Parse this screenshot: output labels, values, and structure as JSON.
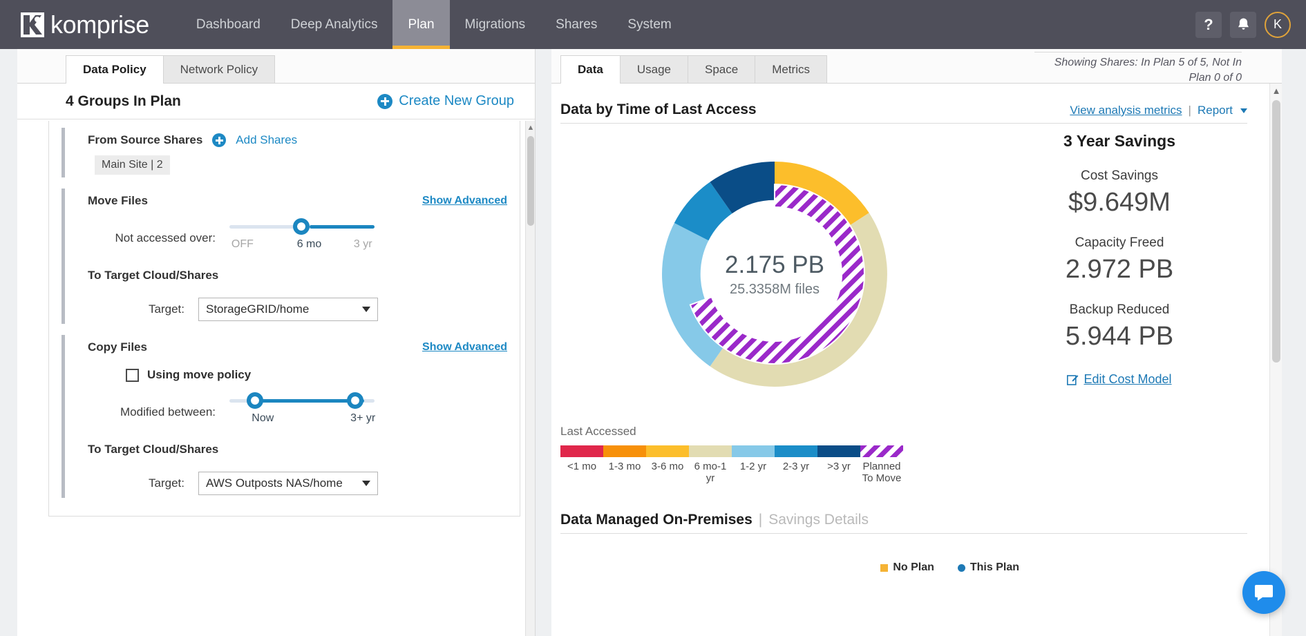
{
  "nav": {
    "brand": "komprise",
    "items": [
      {
        "label": "Dashboard",
        "active": false
      },
      {
        "label": "Deep Analytics",
        "active": false
      },
      {
        "label": "Plan",
        "active": true
      },
      {
        "label": "Migrations",
        "active": false
      },
      {
        "label": "Shares",
        "active": false
      },
      {
        "label": "System",
        "active": false
      }
    ],
    "help_icon": "?",
    "bell_icon": "bell-icon",
    "avatar_initial": "K"
  },
  "left": {
    "tabs": [
      {
        "label": "Data Policy",
        "active": true
      },
      {
        "label": "Network Policy",
        "active": false
      }
    ],
    "groups_title": "4 Groups In Plan",
    "create_group": "Create New Group",
    "source": {
      "title": "From Source Shares",
      "add_link": "Add Shares",
      "chip": "Main Site | 2"
    },
    "move": {
      "title": "Move Files",
      "advanced": "Show Advanced",
      "slider_label": "Not accessed over:",
      "ticks": [
        "OFF",
        "6 mo",
        "3 yr"
      ],
      "selected_tick": "6 mo",
      "target_head": "To Target Cloud/Shares",
      "target_label": "Target:",
      "target_value": "StorageGRID/home"
    },
    "copy": {
      "title": "Copy Files",
      "advanced": "Show Advanced",
      "checkbox_label": "Using move policy",
      "checkbox_checked": false,
      "slider_label": "Modified between:",
      "ticks": [
        "Now",
        "3+ yr"
      ],
      "target_head": "To Target Cloud/Shares",
      "target_label": "Target:",
      "target_value": "AWS Outposts NAS/home"
    }
  },
  "right": {
    "tabs": [
      {
        "label": "Data",
        "active": true
      },
      {
        "label": "Usage",
        "active": false
      },
      {
        "label": "Space",
        "active": false
      },
      {
        "label": "Metrics",
        "active": false
      }
    ],
    "showing_shares": "Showing Shares: In Plan 5 of 5, Not In Plan 0 of 0",
    "section_title": "Data by Time of Last Access",
    "view_metrics_link": "View analysis metrics",
    "report_link": "Report",
    "savings": {
      "heading": "3 Year Savings",
      "items": [
        {
          "label": "Cost Savings",
          "value": "$9.649M"
        },
        {
          "label": "Capacity Freed",
          "value": "2.972 PB"
        },
        {
          "label": "Backup Reduced",
          "value": "5.944 PB"
        }
      ],
      "edit_link": "Edit Cost Model"
    },
    "legend_title": "Last Accessed",
    "bottom": {
      "title": "Data Managed On-Premises",
      "separator": "|",
      "subtitle": "Savings Details",
      "mini_legend": [
        {
          "label": "No Plan",
          "color": "#f5b335",
          "shape": "square"
        },
        {
          "label": "This Plan",
          "color": "#1d79b5",
          "shape": "dot"
        }
      ]
    }
  },
  "chart_data": {
    "type": "pie",
    "title": "Data by Time of Last Access",
    "center_value": "2.175 PB",
    "center_subtitle": "25.3358M files",
    "legend_title": "Last Accessed",
    "legend_position": "bottom",
    "categories": [
      "<1 mo",
      "1-3 mo",
      "3-6 mo",
      "6 mo-1 yr",
      "1-2 yr",
      "2-3 yr",
      ">3 yr",
      "Planned To Move"
    ],
    "colors": [
      "#e0274b",
      "#f79009",
      "#fcbe2b",
      "#e2dcb2",
      "#86c9e8",
      "#1b8dc8",
      "#0a4d87",
      "#9a29c9"
    ],
    "values": [
      0,
      0,
      15.8,
      24.5,
      27.2,
      17.2,
      15.3,
      0
    ],
    "unit": "percent",
    "ring_outer": {
      "segments": [
        {
          "name": "3-6 mo",
          "color": "#fcbe2b",
          "percent": 15.8,
          "start_deg": 0,
          "end_deg": 57
        },
        {
          "name": "6 mo-1 yr",
          "color": "#e2dcb2",
          "percent": 24.5,
          "start_deg": 57,
          "end_deg": 145
        },
        {
          "name": "1-2 yr",
          "color": "#86c9e8",
          "percent": 27.2,
          "start_deg": 145,
          "end_deg": 243
        },
        {
          "name": "2-3 yr",
          "color": "#1b8dc8",
          "percent": 17.2,
          "start_deg": 243,
          "end_deg": 305
        },
        {
          "name": ">3 yr",
          "color": "#0a4d87",
          "percent": 15.3,
          "start_deg": 305,
          "end_deg": 360
        }
      ]
    },
    "ring_inner": {
      "name": "Planned To Move",
      "color": "#9a29c9",
      "pattern": "diagonal-stripes",
      "percent": 69.4,
      "start_deg": 0,
      "end_deg": 250
    }
  }
}
